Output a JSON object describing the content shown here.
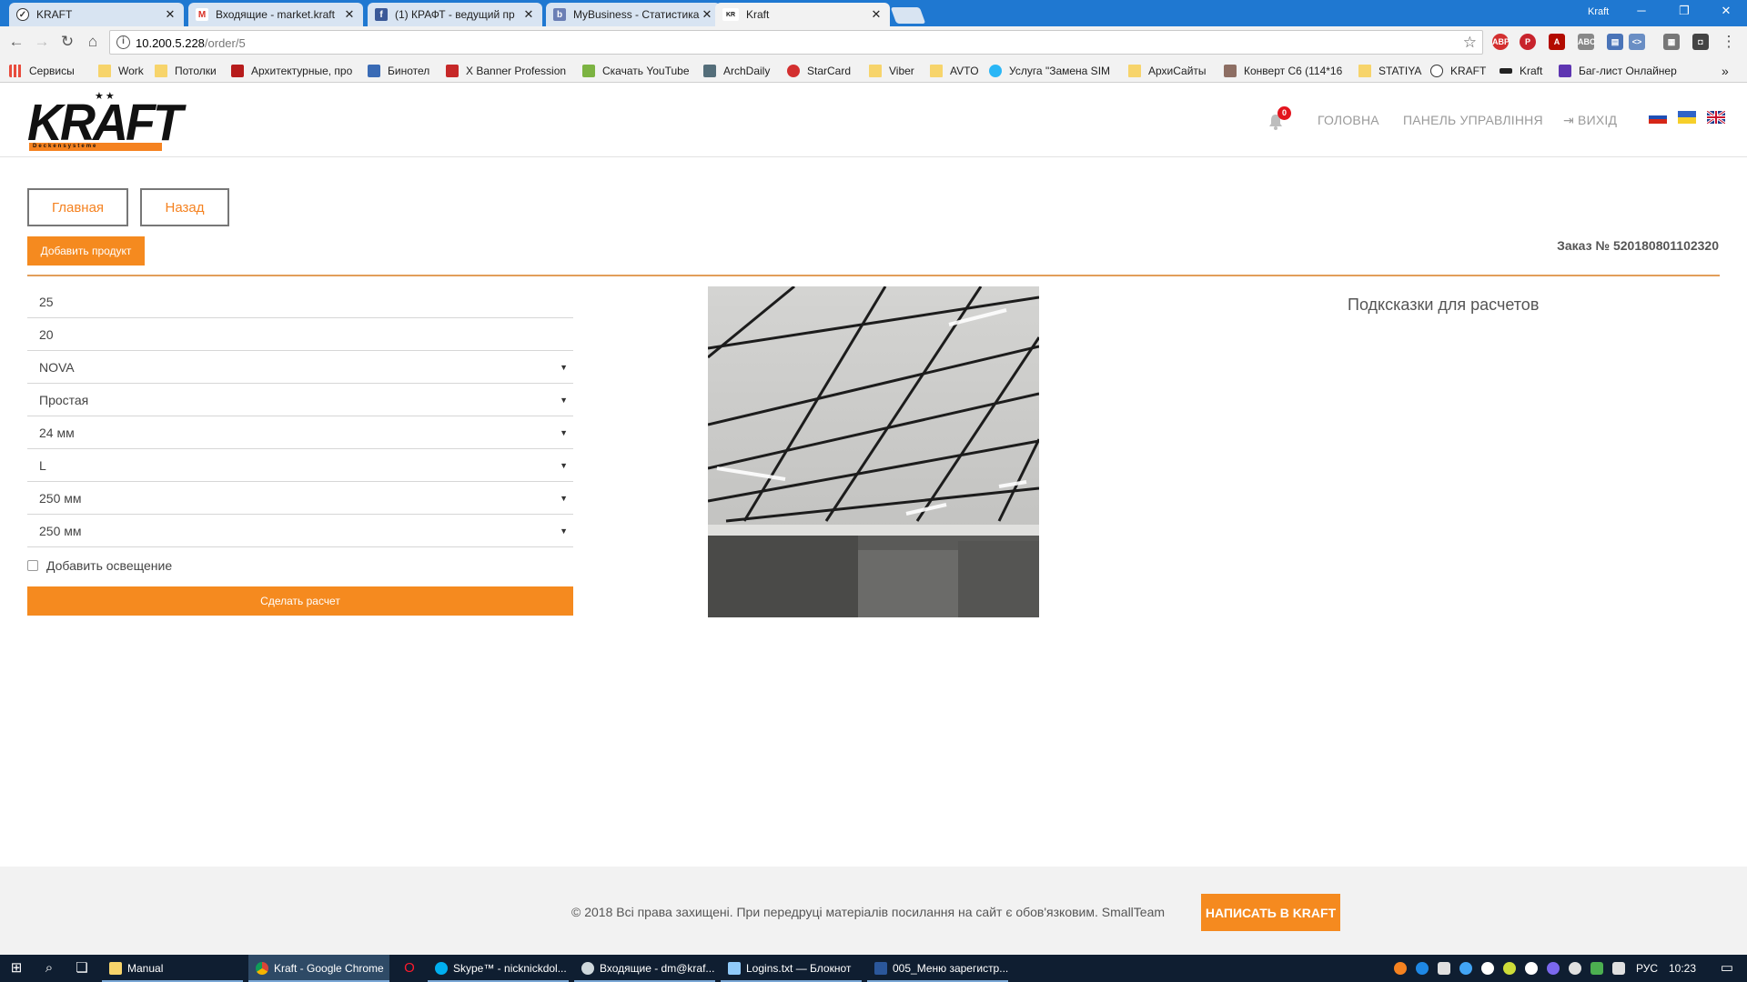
{
  "browser": {
    "tabs": [
      {
        "label": "KRAFT",
        "icon": "kraft-tab-icon"
      },
      {
        "label": "Входящие - market.kraft",
        "icon": "gmail-icon"
      },
      {
        "label": "(1) КРАФТ - ведущий пр",
        "icon": "facebook-icon"
      },
      {
        "label": "MyBusiness - Статистика",
        "icon": "mybusiness-icon"
      },
      {
        "label": "Kraft",
        "icon": "kraft-logo-icon"
      }
    ],
    "profile": "Kraft",
    "url_host": "10.200.5.228",
    "url_path": "/order/5",
    "bookmarks": [
      "Сервисы",
      "Work",
      "Потолки",
      "Архитектурные, про",
      "Бинотел",
      "X Banner Profession",
      "Скачать YouTube",
      "ArchDaily",
      "StarCard",
      "Viber",
      "AVTO",
      "Услуга \"Замена SIM",
      "АрхиСайты",
      "Конверт С6 (114*16",
      "STATIYA",
      "KRAFT",
      "Kraft",
      "Баг-лист Онлайнер"
    ]
  },
  "header": {
    "notifications_count": "0",
    "nav": [
      "ГОЛОВНА",
      "ПАНЕЛЬ УПРАВЛІННЯ",
      "ВИХІД"
    ],
    "logo_text": "KRAFT",
    "logo_tagline": "Deckensysteme",
    "languages": [
      "ru",
      "ua",
      "en"
    ]
  },
  "page": {
    "main_button": "Главная",
    "back_button": "Назад",
    "add_product_button": "Добавить продукт",
    "order_number": "Заказ № 520180801102320",
    "fields": {
      "length": "25",
      "width": "20",
      "collection": "NOVA",
      "type": "Простая",
      "profile_width": "24 мм",
      "profile_shape": "L",
      "tile_length": "250 мм",
      "tile_width": "250 мм"
    },
    "lighting_label": "Добавить освещение",
    "calculate_button": "Сделать расчет",
    "hints_title": "Подксказки для расчетов"
  },
  "footer": {
    "copyright": "© 2018 Всі права захищені. При передруці матеріалів посилання на сайт є обов'язковим. SmallTeam",
    "write_button": "НАПИСАТЬ В KRAFT"
  },
  "taskbar": {
    "apps": [
      "Manual",
      "Kraft - Google Chrome",
      "Skype™ - nicknickdol...",
      "Входящие - dm@kraf...",
      "Logins.txt — Блокнот",
      "005_Меню зарегистр..."
    ],
    "language": "РУС",
    "time": "10:23"
  },
  "colors": {
    "accent": "#f58a1f",
    "chrome_titlebar": "#1f78d1",
    "taskbar": "#0f1e31"
  }
}
